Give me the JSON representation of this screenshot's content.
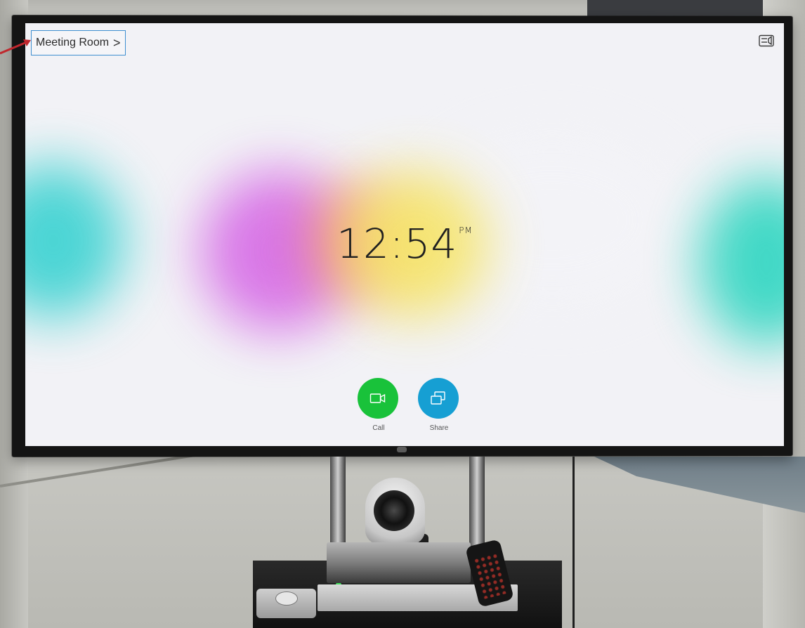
{
  "screen": {
    "room_label": "Meeting Room",
    "room_chevron": ">",
    "clock": {
      "time": "12:54",
      "ampm": "PM"
    },
    "actions": [
      {
        "label": "Call",
        "color": "#19c23a",
        "icon": "video-camera-icon"
      },
      {
        "label": "Share",
        "color": "#169fd3",
        "icon": "share-screen-icon"
      }
    ],
    "top_right_icon": "settings-icon"
  },
  "colors": {
    "label_border": "#3f8fd0",
    "annotation_arrow": "#c0272d"
  }
}
